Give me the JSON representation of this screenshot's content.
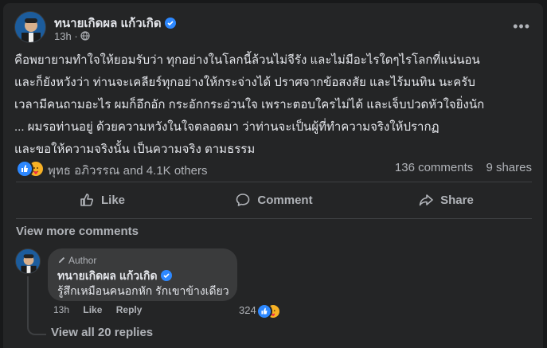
{
  "post": {
    "author": "ทนายเกิดผล แก้วเกิด",
    "time": "13h",
    "privacy_icon": "globe-icon",
    "lines": [
      "คือพยายามทำใจให้ยอมรับว่า ทุกอย่างในโลกนี้ล้วนไม่จีรัง และไม่มีอะไรใดๆไรโลกที่แน่นอน",
      "และก็ยังหวังว่า ท่านจะเคลียร์ทุกอย่างให้กระจ่างได้ ปราศจากข้อสงสัย และไร้มนทิน นะครับ",
      "  เวลามีคนถามอะไร  ผมก็อึกอัก กระอักกระอ่วนใจ เพราะตอบใครไม่ได้ และเจ็บปวดหัวใจยิ่งนัก",
      " ... ผมรอท่านอยู่  ด้วยความหวังในใจตลอดมา  ว่าท่านจะเป็นผู้ที่ทำความจริงให้ปรากฏ",
      "และขอให้ความจริงนั้น เป็นความจริง ตามธรรม"
    ]
  },
  "stats": {
    "reactions_text": "พุทธ อภิวรรณ and 4.1K others",
    "comments": "136 comments",
    "shares": "9 shares"
  },
  "actions": {
    "like": "Like",
    "comment": "Comment",
    "share": "Share"
  },
  "view_more_comments": "View more comments",
  "comment": {
    "badge": "Author",
    "author": "ทนายเกิดผล แก้วเกิด",
    "text": "รู้สึกเหมือนคนอกหัก รักเขาข้างเดียว",
    "time": "13h",
    "like": "Like",
    "reply": "Reply",
    "reaction_count": "324"
  },
  "view_replies": "View all 20 replies",
  "colors": {
    "background": "#18191a",
    "card": "#242526",
    "bubble": "#3a3b3c",
    "accent": "#2d88ff",
    "text_primary": "#e4e6eb",
    "text_secondary": "#b0b3b8"
  }
}
